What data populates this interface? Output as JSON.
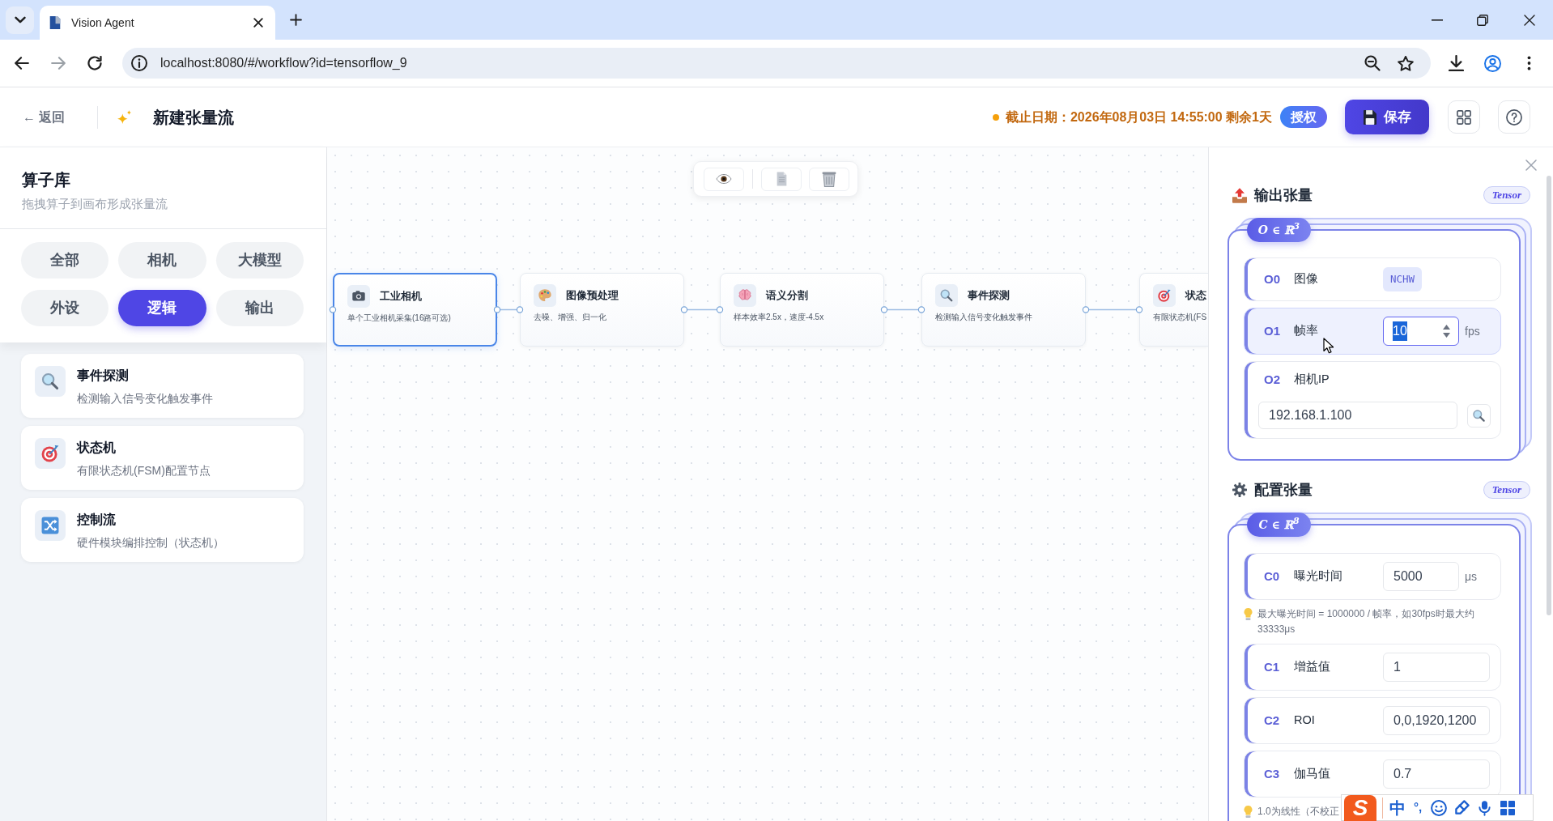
{
  "browser": {
    "tab_title": "Vision Agent",
    "url": "localhost:8080/#/workflow?id=tensorflow_9"
  },
  "header": {
    "back": "← 返回",
    "title": "新建张量流",
    "deadline": "截止日期：2026年08月03日 14:55:00 剩余1天",
    "license": "授权",
    "save": "保存"
  },
  "sidebar": {
    "title": "算子库",
    "subtitle": "拖拽算子到画布形成张量流",
    "categories": [
      {
        "label": "全部",
        "selected": false
      },
      {
        "label": "相机",
        "selected": false
      },
      {
        "label": "大模型",
        "selected": false
      },
      {
        "label": "外设",
        "selected": false
      },
      {
        "label": "逻辑",
        "selected": true
      },
      {
        "label": "输出",
        "selected": false
      }
    ],
    "operators": [
      {
        "kind": "event",
        "name": "事件探测",
        "desc": "检测输入信号变化触发事件"
      },
      {
        "kind": "fsm",
        "name": "状态机",
        "desc": "有限状态机(FSM)配置节点"
      },
      {
        "kind": "control",
        "name": "控制流",
        "desc": "硬件模块编排控制（状态机）"
      }
    ]
  },
  "canvas": {
    "nodes": [
      {
        "kind": "camera",
        "title": "工业相机",
        "desc": "单个工业相机采集(16路可选)",
        "selected": true
      },
      {
        "kind": "preprocess",
        "title": "图像预处理",
        "desc": "去噪、增强、归一化",
        "selected": false
      },
      {
        "kind": "segmentation",
        "title": "语义分割",
        "desc": "样本效率2.5x，速度-4.5x",
        "selected": false
      },
      {
        "kind": "event",
        "title": "事件探测",
        "desc": "检测输入信号变化触发事件",
        "selected": false
      },
      {
        "kind": "fsm",
        "title": "状态",
        "desc": "有限状态机(FS",
        "selected": false
      }
    ]
  },
  "panel": {
    "sections": [
      {
        "kind": "output",
        "title": "输出张量",
        "badge": "Tensor",
        "symbol": "O ∈ ℝ$^{3}$",
        "params": [
          {
            "kind": "tag",
            "id": "O0",
            "name": "图像",
            "value": "NCHW",
            "focused": false
          },
          {
            "kind": "stepper",
            "id": "O1",
            "name": "帧率",
            "value": "10",
            "unit": "fps",
            "focused": true
          },
          {
            "kind": "lookup",
            "id": "O2",
            "name": "相机IP",
            "value": "192.168.1.100",
            "focused": false
          }
        ]
      },
      {
        "kind": "config",
        "title": "配置张量",
        "badge": "Tensor",
        "symbol": "C ∈ ℝ$^{8}$",
        "params": [
          {
            "kind": "field",
            "id": "C0",
            "name": "曝光时间",
            "value": "5000",
            "unit": "μs",
            "hint": "最大曝光时间 = 1000000 / 帧率，如30fps时最大约33333μs",
            "focused": false
          },
          {
            "kind": "field",
            "id": "C1",
            "name": "增益值",
            "value": "1",
            "focused": false
          },
          {
            "kind": "field",
            "id": "C2",
            "name": "ROI",
            "value": "0,0,1920,1200",
            "focused": false
          },
          {
            "kind": "field",
            "id": "C3",
            "name": "伽马值",
            "value": "0.7",
            "hint": "1.0为线性（不校正",
            "focused": false
          }
        ]
      }
    ]
  },
  "ime_toolbar": {
    "logo": "S",
    "mode": "中",
    "punctuation": "°,"
  }
}
